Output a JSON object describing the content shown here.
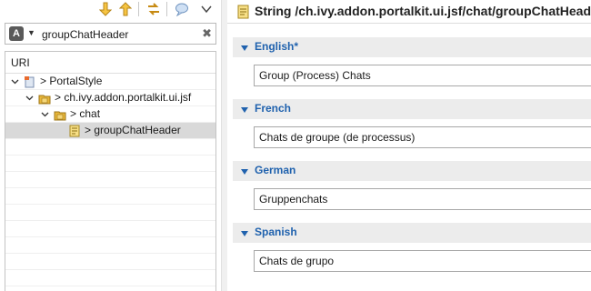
{
  "toolbar": {
    "icons": [
      "arrow-down-icon",
      "arrow-up-icon",
      "link-editor-icon",
      "comment-icon",
      "view-menu-icon"
    ]
  },
  "search": {
    "mode_icon": "A",
    "value": "groupChatHeader"
  },
  "tree": {
    "column_header": "URI",
    "rows": [
      {
        "label": "> PortalStyle",
        "icon": "project-icon",
        "expanded": true
      },
      {
        "label": "> ch.ivy.addon.portalkit.ui.jsf",
        "icon": "folder-icon",
        "expanded": true
      },
      {
        "label": "> chat",
        "icon": "folder-icon",
        "expanded": true
      },
      {
        "label": "> groupChatHeader",
        "icon": "string-cms-icon",
        "selected": true
      }
    ]
  },
  "editor": {
    "title": "String /ch.ivy.addon.portalkit.ui.jsf/chat/groupChatHeader",
    "sections": [
      {
        "language": "English*",
        "value": "Group (Process) Chats"
      },
      {
        "language": "French",
        "value": "Chats de groupe (de processus)"
      },
      {
        "language": "German",
        "value": "Gruppenchats"
      },
      {
        "language": "Spanish",
        "value": "Chats de grupo"
      }
    ]
  },
  "colors": {
    "section_title": "#2062ae",
    "section_header_bg": "#ececec",
    "selected_row_bg": "#d9d9d9",
    "folder_icon": "#e8b73a"
  }
}
